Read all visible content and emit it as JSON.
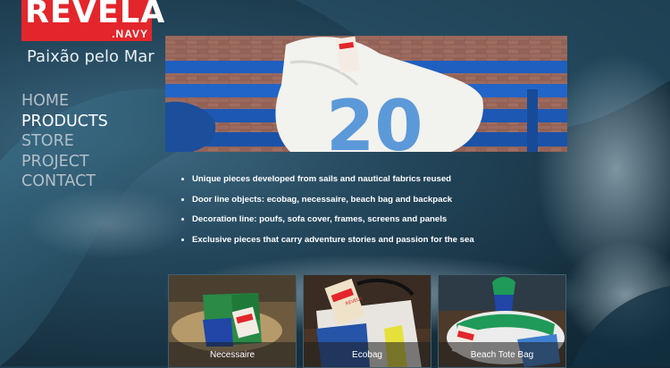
{
  "brand": {
    "logo_main": "REVELA",
    "logo_sub": ".NAVY",
    "tagline": "Paixão pelo Mar"
  },
  "nav": {
    "items": [
      {
        "label": "HOME",
        "active": false
      },
      {
        "label": "PRODUCTS",
        "active": true
      },
      {
        "label": "STORE",
        "active": false
      },
      {
        "label": "PROJECT",
        "active": false
      },
      {
        "label": "CONTACT",
        "active": false
      }
    ]
  },
  "features": [
    "Unique pieces developed from sails and nautical fabrics reused",
    "Door line objects: ecobag, necessaire, beach bag and backpack",
    "Decoration line: poufs, sofa cover, frames, screens and panels",
    "Exclusive pieces that carry adventure stories and passion for the sea"
  ],
  "products": [
    {
      "label": "Necessaire"
    },
    {
      "label": "Ecobag"
    },
    {
      "label": "Beach Tote Bag"
    }
  ],
  "hero_numeral": "20",
  "tag_text": "REVELA",
  "colors": {
    "brand_red": "#e3262b",
    "nav_active": "#ffffff",
    "nav_inactive": "#b3bec6",
    "bench_blue": "#1f5fc0"
  }
}
